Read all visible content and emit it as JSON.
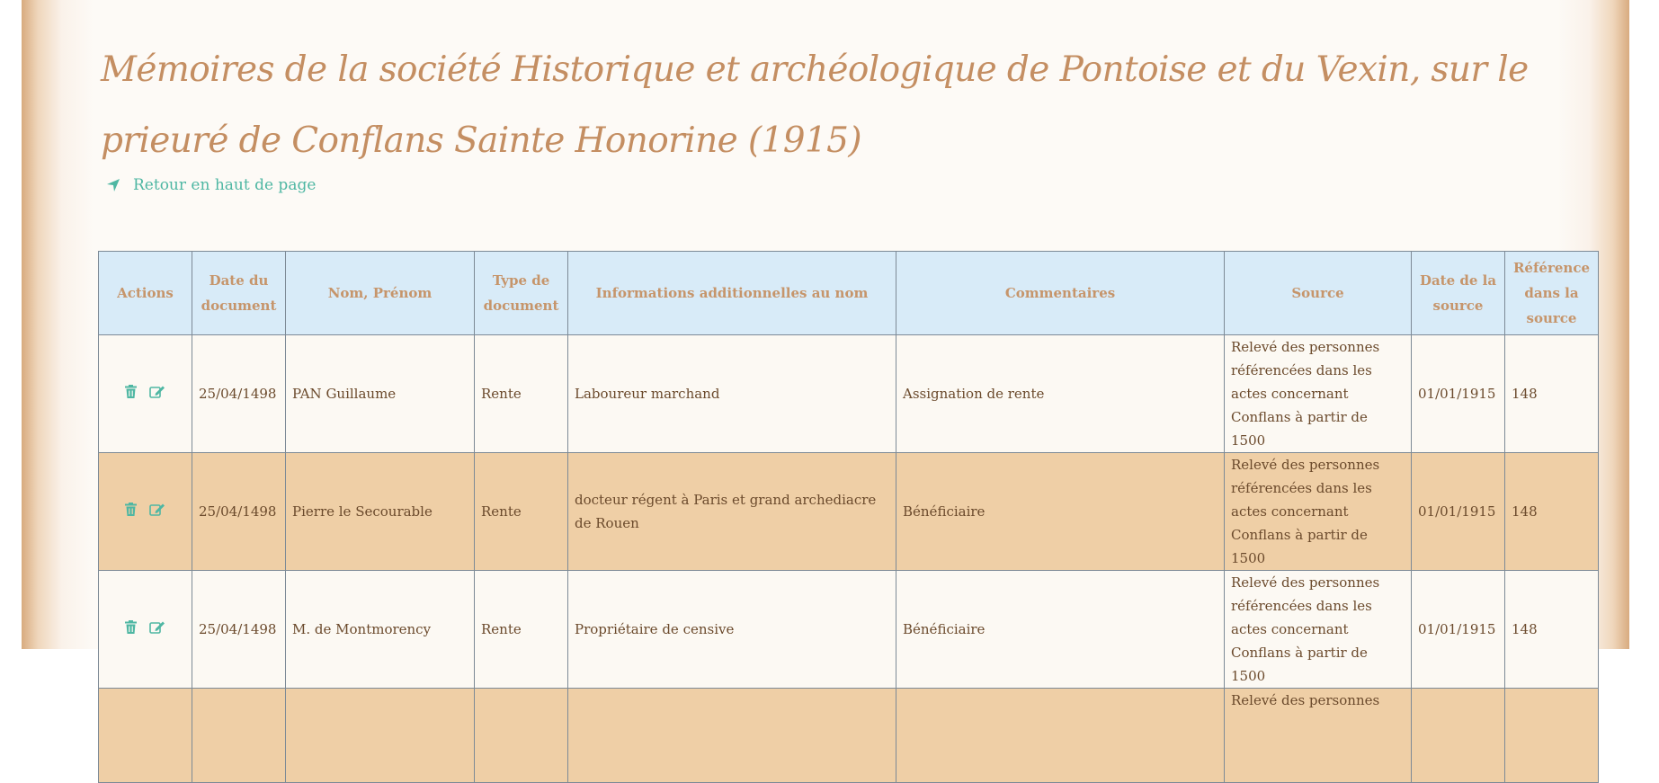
{
  "page": {
    "title": "Mémoires de la société Historique et archéologique de Pontoise et du Vexin, sur le prieuré de Conflans Sainte Honorine (1915)",
    "back_link": "Retour en haut de page"
  },
  "colors": {
    "title": "#c48e62",
    "link": "#4fb7a3",
    "header_bg": "#d8ebf8",
    "row_light": "#fcf9f3",
    "row_dark": "#efcfa6"
  },
  "table": {
    "headers": [
      "Actions",
      "Date du document",
      "Nom, Prénom",
      "Type de document",
      "Informations additionnelles au nom",
      "Commentaires",
      "Source",
      "Date de la source",
      "Référence dans la source"
    ],
    "rows": [
      {
        "date": "25/04/1498",
        "name": "PAN Guillaume",
        "type": "Rente",
        "info": "Laboureur marchand",
        "comment": "Assignation de rente",
        "source": "Relevé des personnes référencées dans les actes concernant Conflans à partir de 1500",
        "source_date": "01/01/1915",
        "ref": "148"
      },
      {
        "date": "25/04/1498",
        "name": "Pierre le Secourable",
        "type": "Rente",
        "info": "docteur régent à Paris et grand archediacre de Rouen",
        "comment": "Bénéficiaire",
        "source": "Relevé des personnes référencées dans les actes concernant Conflans à partir de 1500",
        "source_date": "01/01/1915",
        "ref": "148"
      },
      {
        "date": "25/04/1498",
        "name": "M. de Montmorency",
        "type": "Rente",
        "info": "Propriétaire de censive",
        "comment": "Bénéficiaire",
        "source": "Relevé des personnes référencées dans les actes concernant Conflans à partir de 1500",
        "source_date": "01/01/1915",
        "ref": "148"
      },
      {
        "date": "",
        "name": "",
        "type": "",
        "info": "",
        "comment": "",
        "source": "Relevé des personnes",
        "source_date": "",
        "ref": ""
      }
    ],
    "action_icons": [
      "trash-icon",
      "edit-icon"
    ]
  }
}
